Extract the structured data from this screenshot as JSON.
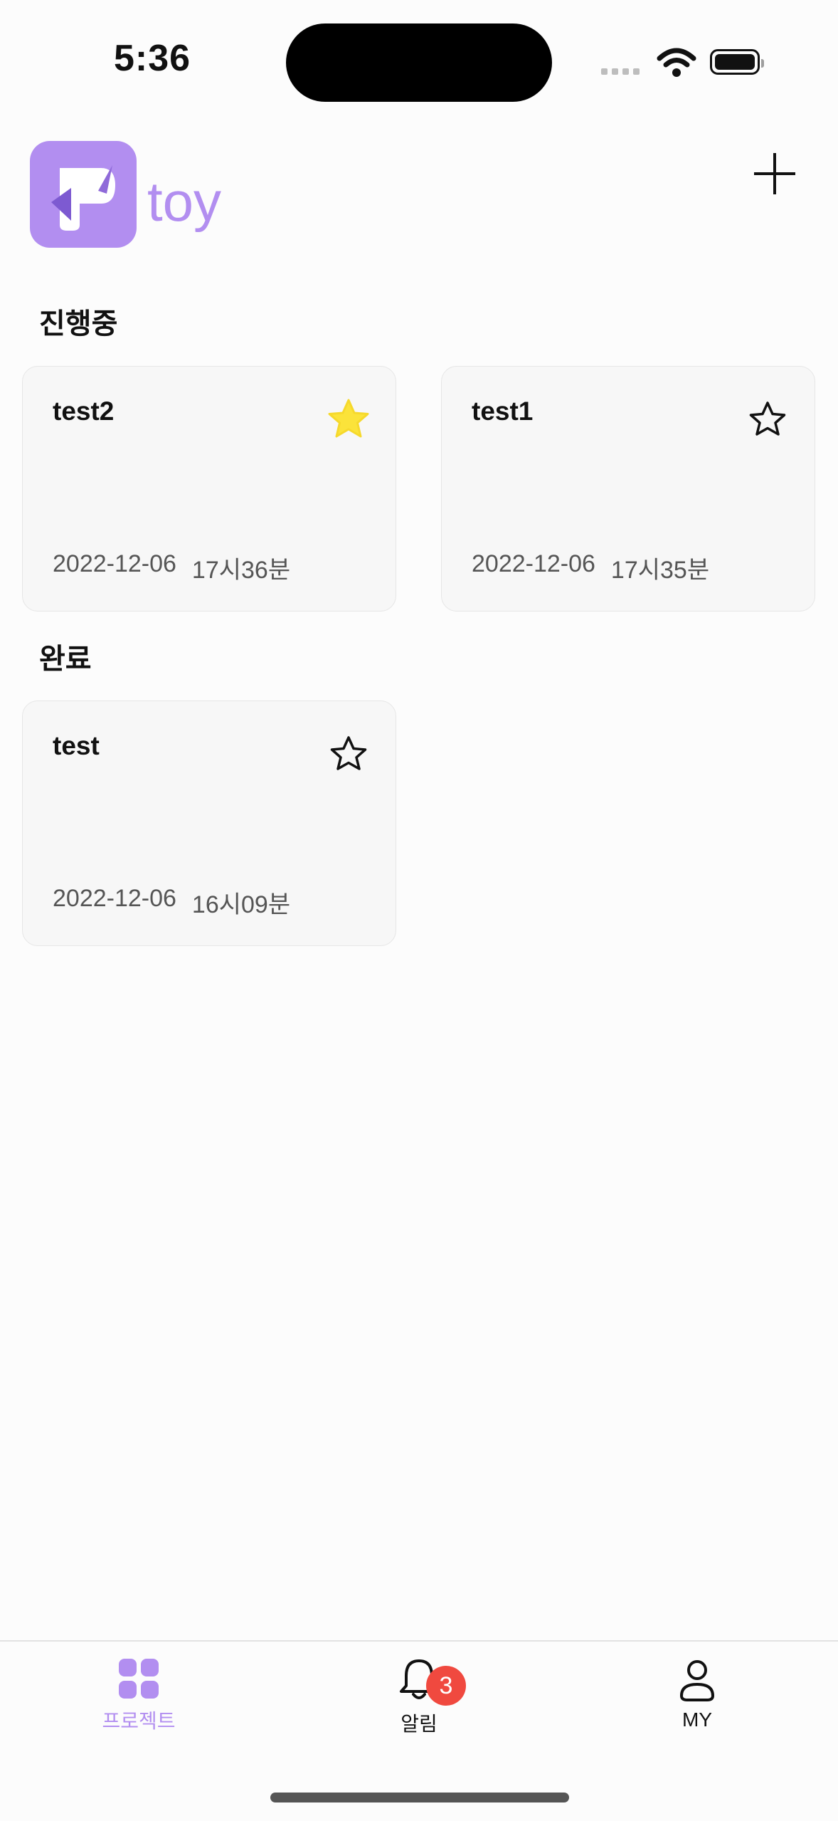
{
  "status_bar": {
    "time": "5:36"
  },
  "app": {
    "logo_text": "toy",
    "logo_letter": "F"
  },
  "sections": {
    "in_progress": "진행중",
    "completed": "완료"
  },
  "cards": [
    {
      "title": "test2",
      "date": "2022-12-06",
      "time": "17시36분",
      "starred": true
    },
    {
      "title": "test1",
      "date": "2022-12-06",
      "time": "17시35분",
      "starred": false
    },
    {
      "title": "test",
      "date": "2022-12-06",
      "time": "16시09분",
      "starred": false
    }
  ],
  "tab_bar": {
    "tabs": [
      {
        "label": "프로젝트",
        "icon": "grid-icon",
        "active": true
      },
      {
        "label": "알림",
        "icon": "bell-icon",
        "badge": "3",
        "active": false
      },
      {
        "label": "MY",
        "icon": "person-icon",
        "active": false
      }
    ]
  },
  "colors": {
    "accent": "#b28ef0",
    "star_filled": "#fbe33a",
    "badge": "#f0493f",
    "card_bg": "#f7f7f7"
  }
}
